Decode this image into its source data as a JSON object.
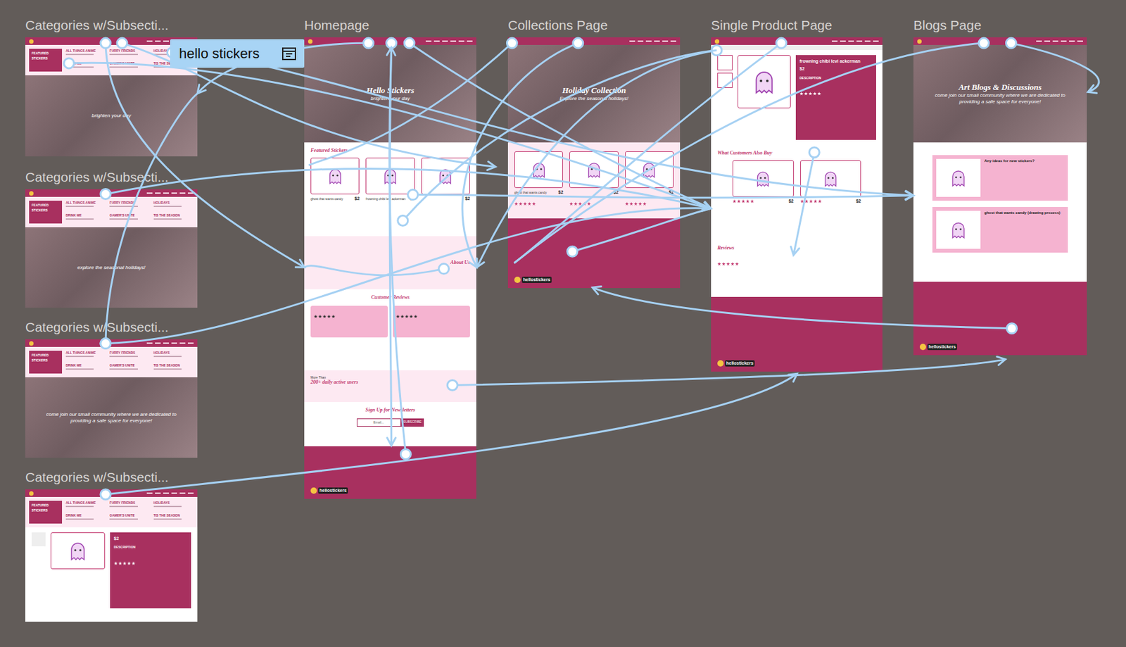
{
  "tooltip": {
    "label": "hello stickers"
  },
  "brand": "hellostickers",
  "menu_columns": [
    "FEATURED STICKERS",
    "ALL THINGS ANIME",
    "FURRY FRIENDS",
    "HOLIDAYS",
    "DRINK ME",
    "GAMER'S UNITE",
    "TIS THE SEASON"
  ],
  "frames": [
    {
      "title": "Categories w/Subsecti...",
      "kind": "categories",
      "hero": "brighten your day"
    },
    {
      "title": "Categories w/Subsecti...",
      "kind": "categories",
      "hero": "explore the seasonal holidays!"
    },
    {
      "title": "Categories w/Subsecti...",
      "kind": "categories",
      "hero": "come join our small community where we are dedicated to providing a safe space for everyone!"
    },
    {
      "title": "Categories w/Subsecti...",
      "kind": "catproduct",
      "price": "$2",
      "description": "DESCRIPTION",
      "stars": 5
    },
    {
      "title": "Homepage",
      "kind": "home",
      "hero_title": "Hello Stickers",
      "hero_text": "brighten your day",
      "featured": "Featured Stickers",
      "products": [
        {
          "name": "ghost that wants candy",
          "price": "$2"
        },
        {
          "name": "frowning chibi levi ackerman",
          "price": "$2"
        },
        {
          "name": "",
          "price": "$2"
        }
      ],
      "about": "About Us",
      "reviews_title": "Customer Reviews",
      "reviews": [
        {
          "stars": 5
        },
        {
          "stars": 5
        }
      ],
      "stat_top": "More Than",
      "stat": "200+ daily active users",
      "newsletter": "Sign Up for Newsletters",
      "email": "Email...",
      "subscribe": "SUBSCRIBE"
    },
    {
      "title": "Collections Page",
      "kind": "collections",
      "hero_title": "Holiday Collection",
      "hero_text": "Explore the seasonal holidays!",
      "products": [
        {
          "name": "ghost that wants candy",
          "price": "$2",
          "stars": 5
        },
        {
          "name": "",
          "price": "$2",
          "stars": 5
        },
        {
          "name": "",
          "price": "$2",
          "stars": 5
        }
      ]
    },
    {
      "title": "Single Product Page",
      "kind": "product",
      "name": "frowning chibi levi ackerman",
      "price": "$2",
      "description": "DESCRIPTION",
      "stars": 5,
      "also_title": "What Customers Also Buy",
      "also": [
        {
          "price": "$2",
          "stars": 5
        },
        {
          "price": "$2",
          "stars": 5
        }
      ],
      "reviews_title": "Reviews",
      "review_stars": 5
    },
    {
      "title": "Blogs Page",
      "kind": "blogs",
      "hero_title": "Art Blogs & Discussions",
      "hero_text": "come join our small community where we are dedicated to providing a safe space for everyone!",
      "posts": [
        {
          "title": "Any ideas for new stickers?"
        },
        {
          "title": "ghost that wants candy (drawing process)"
        }
      ]
    }
  ]
}
